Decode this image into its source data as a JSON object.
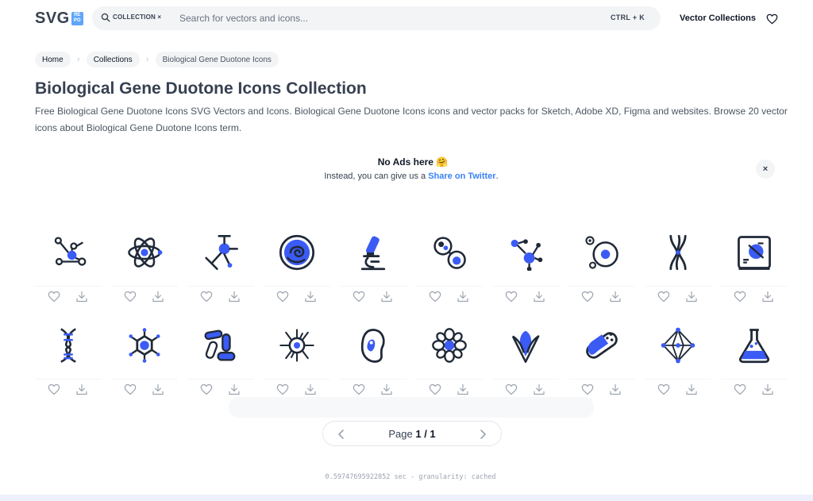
{
  "header": {
    "logo_text": "SVG",
    "logo_badge": "RE PO",
    "search_chip": "COLLECTION ×",
    "search_placeholder": "Search for vectors and icons...",
    "shortcut": "CTRL + K",
    "nav_link": "Vector Collections"
  },
  "breadcrumb": [
    "Home",
    "Collections",
    "Biological Gene Duotone Icons"
  ],
  "page": {
    "title": "Biological Gene Duotone Icons Collection",
    "description": "Free Biological Gene Duotone Icons SVG Vectors and Icons. Biological Gene Duotone Icons icons and vector packs for Sketch, Adobe XD, Figma and websites. Browse 20 vector icons about Biological Gene Duotone Icons term."
  },
  "ads": {
    "title": "No Ads here 🤗",
    "text_before": "Instead, you can give us a ",
    "link": "Share on Twitter",
    "text_after": ".",
    "close": "×"
  },
  "icons": [
    {
      "name": "molecule-network-icon"
    },
    {
      "name": "atom-icon"
    },
    {
      "name": "molecule-structure-icon"
    },
    {
      "name": "bacteria-cell-icon"
    },
    {
      "name": "microscope-icon"
    },
    {
      "name": "cells-dividing-icon"
    },
    {
      "name": "molecule-nodes-icon"
    },
    {
      "name": "cell-nucleus-icon"
    },
    {
      "name": "chromosome-icon"
    },
    {
      "name": "lab-test-screen-icon"
    },
    {
      "name": "dna-helix-icon"
    },
    {
      "name": "virus-icon"
    },
    {
      "name": "bacteria-group-icon"
    },
    {
      "name": "spiky-cell-icon"
    },
    {
      "name": "bean-cell-icon"
    },
    {
      "name": "flower-cell-icon"
    },
    {
      "name": "corn-icon"
    },
    {
      "name": "capsule-pill-icon"
    },
    {
      "name": "crystal-structure-icon"
    },
    {
      "name": "flask-icon"
    }
  ],
  "pagination": {
    "label": "Page",
    "current": "1",
    "total": "1"
  },
  "footer": {
    "timing": "0.59747695922852 sec - granularity: cached"
  },
  "colors": {
    "accent": "#3b5bf5",
    "ink": "#1f2937",
    "link": "#3b82f6"
  }
}
